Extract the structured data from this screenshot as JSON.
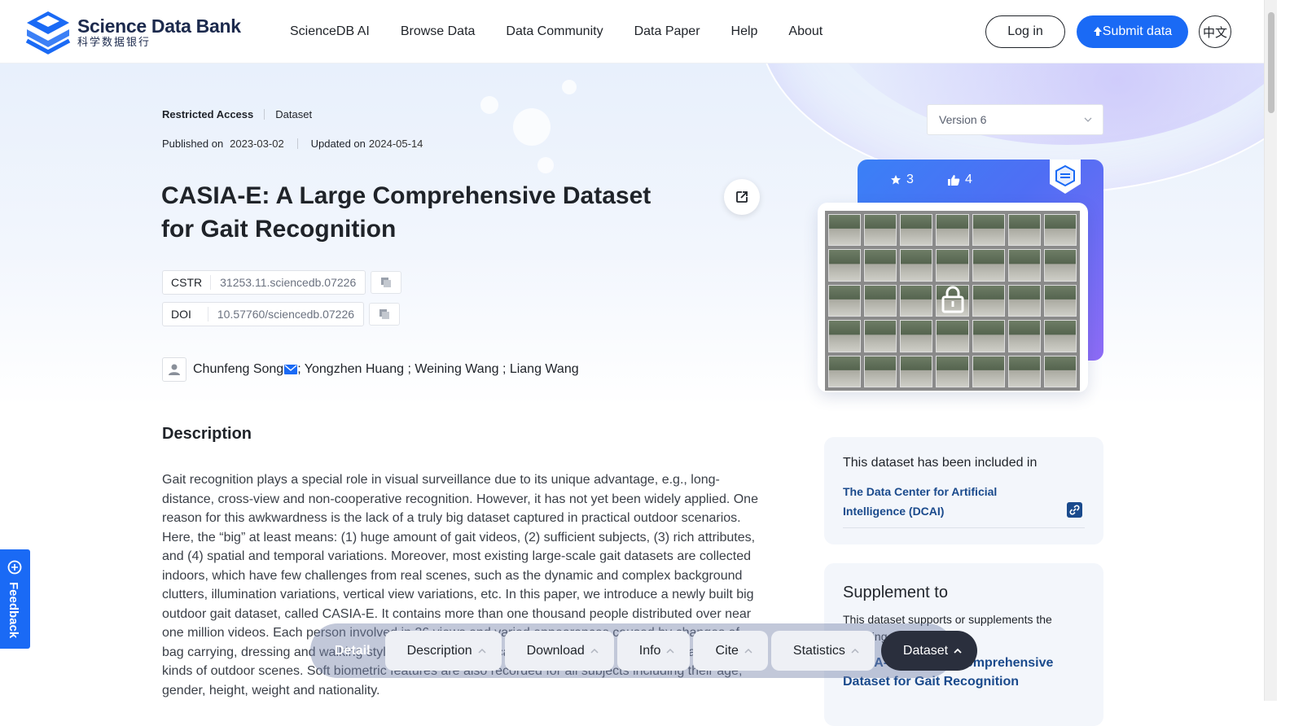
{
  "brand": {
    "name_en": "Science Data Bank",
    "name_cn": "科学数据银行"
  },
  "nav": {
    "items": [
      "ScienceDB AI",
      "Browse Data",
      "Data Community",
      "Data Paper",
      "Help",
      "About"
    ]
  },
  "header": {
    "login_label": "Log in",
    "submit_label": "Submit data",
    "lang_label": "中文"
  },
  "meta": {
    "access": "Restricted Access",
    "type": "Dataset",
    "published_label": "Published on",
    "published_date": "2023-03-02",
    "updated_label": "Updated on",
    "updated_date": "2024-05-14"
  },
  "dataset": {
    "title": "CASIA-E: A Large Comprehensive Dataset for Gait Recognition"
  },
  "identifiers": {
    "cstr_label": "CSTR",
    "cstr_value": "31253.11.sciencedb.07226",
    "doi_label": "DOI",
    "doi_value": "10.57760/sciencedb.07226"
  },
  "authors": {
    "first": "Chunfeng Song",
    "rest": "; Yongzhen Huang ; Weining Wang ; Liang Wang"
  },
  "description": {
    "heading": "Description",
    "text": "Gait recognition plays a special role in visual surveillance due to its unique advantage, e.g., long-distance, cross-view and non-cooperative recognition. However, it has not yet been widely applied. One reason for this awkwardness is the lack of a truly big dataset captured in practical outdoor scenarios. Here, the “big” at least means: (1) huge amount of gait videos, (2) sufficient subjects, (3) rich attributes, and (4) spatial and temporal variations. Moreover, most existing large-scale gait datasets are collected indoors, which have few challenges from real scenes, such as the dynamic and complex background clutters, illumination variations, vertical view variations, etc. In this paper, we introduce a newly built big outdoor gait dataset, called CASIA-E. It contains more than one thousand people distributed over near one million videos. Each person involved in 26 views and varied appearances caused by changes of bag carrying, dressing and walking styles. The videos are captured across five months and across three kinds of outdoor scenes. Soft biometric features are also recorded for all subjects including their age, gender, height, weight and nationality."
  },
  "sidebar": {
    "version_label": "Version 6",
    "stars": "3",
    "likes": "4",
    "included_heading": "This dataset has been included in",
    "included_link": "The Data Center for Artificial Intelligence (DCAI)",
    "supplement_heading": "Supplement to",
    "supplement_text": "This dataset supports or supplements the following papers",
    "supplement_link": "CASIA-E: A Large Comprehensive Dataset for Gait Recognition"
  },
  "tabbar": {
    "detail_label": "Detail",
    "tabs": [
      "Description",
      "Download",
      "Info",
      "Cite",
      "Statistics"
    ],
    "active_tab": "Dataset"
  },
  "feedback": {
    "label": "Feedback"
  },
  "colors": {
    "primary": "#1a6af5",
    "link": "#1a4a8c",
    "dark": "#2a2f3d"
  }
}
